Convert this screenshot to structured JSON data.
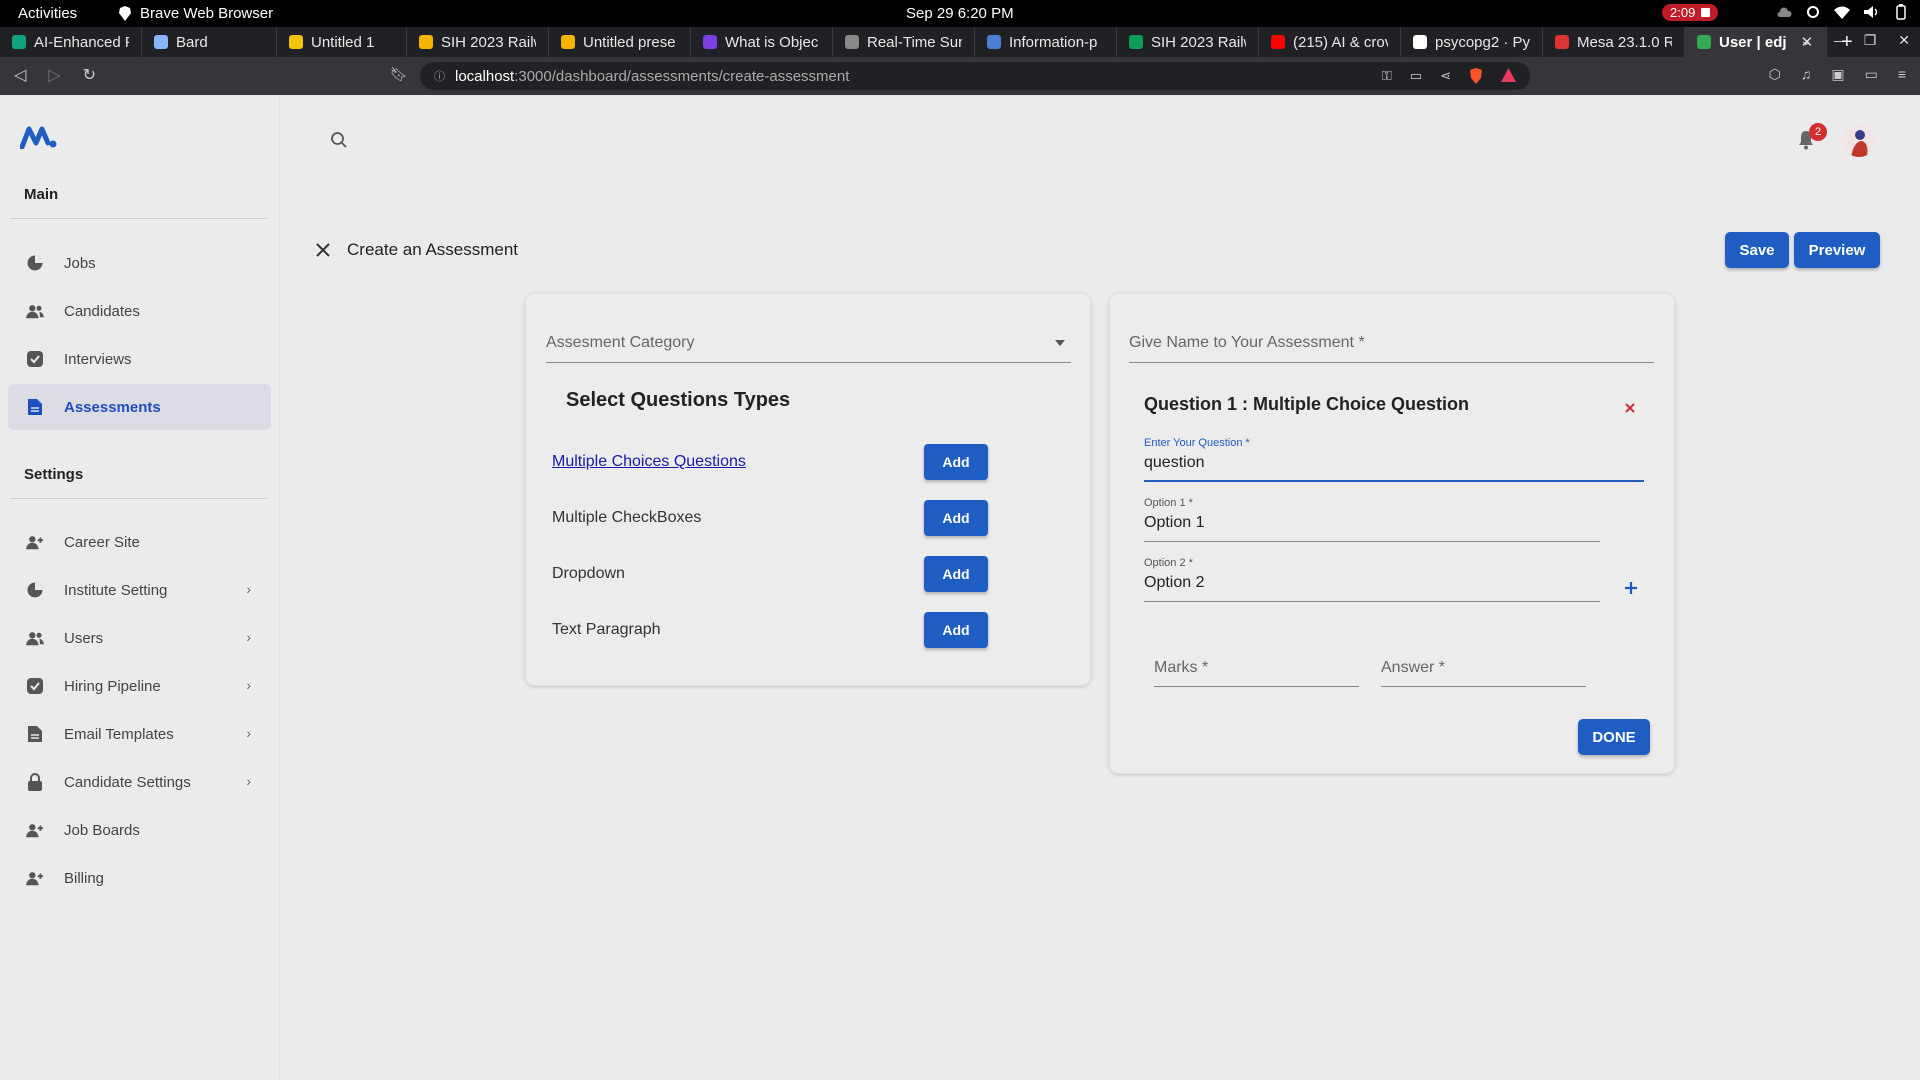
{
  "os_bar": {
    "activities": "Activities",
    "app_name": "Brave Web Browser",
    "clock": "Sep 29  6:20 PM",
    "recording": "2:09"
  },
  "tabs": [
    {
      "title": "AI-Enhanced F",
      "color": "#10a37f"
    },
    {
      "title": "Bard",
      "color": "#8ab4f8"
    },
    {
      "title": "Untitled 1",
      "color": "#f4c20d"
    },
    {
      "title": "SIH 2023 Railw",
      "color": "#f4b400"
    },
    {
      "title": "Untitled prese",
      "color": "#f4b400"
    },
    {
      "title": "What is Objec",
      "color": "#7b3fe4"
    },
    {
      "title": "Real-Time Sur",
      "color": "#888888"
    },
    {
      "title": "Information-p",
      "color": "#4a7fd0"
    },
    {
      "title": "SIH 2023 Railw",
      "color": "#0f9d58"
    },
    {
      "title": "(215) AI & crov",
      "color": "#ff0000"
    },
    {
      "title": "psycopg2 · Py",
      "color": "#ffffff"
    },
    {
      "title": "Mesa 23.1.0 R",
      "color": "#d33"
    },
    {
      "title": "User | edj",
      "color": "#34a853",
      "active": true
    }
  ],
  "url": {
    "host": "localhost",
    "path": ":3000/dashboard/assessments/create-assessment"
  },
  "sidebar": {
    "main_title": "Main",
    "main_items": [
      {
        "label": "Jobs",
        "icon": "pie-chart-icon"
      },
      {
        "label": "Candidates",
        "icon": "people-icon"
      },
      {
        "label": "Interviews",
        "icon": "inbox-icon"
      },
      {
        "label": "Assessments",
        "icon": "document-icon",
        "active": true
      }
    ],
    "settings_title": "Settings",
    "settings_items": [
      {
        "label": "Career Site",
        "icon": "person-add-icon",
        "chevron": false
      },
      {
        "label": "Institute Setting",
        "icon": "pie-chart-icon",
        "chevron": true
      },
      {
        "label": "Users",
        "icon": "people-icon",
        "chevron": true
      },
      {
        "label": "Hiring Pipeline",
        "icon": "inbox-icon",
        "chevron": true
      },
      {
        "label": "Email Templates",
        "icon": "document-icon",
        "chevron": true
      },
      {
        "label": "Candidate Settings",
        "icon": "lock-icon",
        "chevron": true
      },
      {
        "label": "Job Boards",
        "icon": "person-add-icon",
        "chevron": false
      },
      {
        "label": "Billing",
        "icon": "person-add-icon",
        "chevron": false
      }
    ]
  },
  "header": {
    "notification_count": "2"
  },
  "page": {
    "title": "Create an Assessment",
    "save_label": "Save",
    "preview_label": "Preview"
  },
  "left_card": {
    "category_placeholder": "Assesment Category",
    "section_title": "Select Questions Types",
    "add_label": "Add",
    "types": [
      {
        "label": "Multiple Choices Questions",
        "link": true
      },
      {
        "label": "Multiple CheckBoxes",
        "link": false
      },
      {
        "label": "Dropdown",
        "link": false
      },
      {
        "label": "Text Paragraph",
        "link": false
      }
    ]
  },
  "right_card": {
    "name_placeholder": "Give Name to Your Assessment *",
    "question_title": "Question 1 : Multiple Choice Question",
    "question_label": "Enter Your Question *",
    "question_value": "question",
    "option1_label": "Option 1 *",
    "option1_value": "Option 1",
    "option2_label": "Option 2 *",
    "option2_value": "Option 2",
    "marks_placeholder": "Marks *",
    "answer_placeholder": "Answer *",
    "done_label": "DONE"
  },
  "colors": {
    "primary": "#1f5dc2",
    "close_red": "#d32f2f",
    "accent_blue": "#1e4fc2"
  }
}
